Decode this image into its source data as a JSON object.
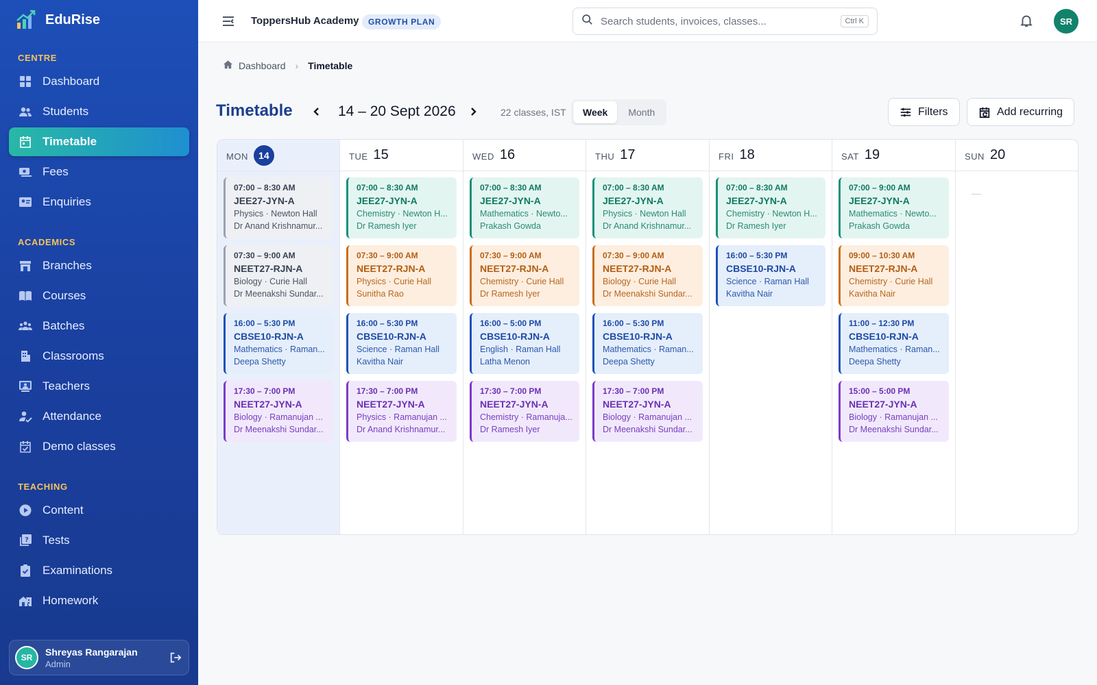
{
  "brand": {
    "name": "EduRise"
  },
  "sidebar": {
    "sections": [
      {
        "title": "CENTRE",
        "items": [
          {
            "label": "Dashboard",
            "icon": "dashboard-icon"
          },
          {
            "label": "Students",
            "icon": "students-icon"
          },
          {
            "label": "Timetable",
            "icon": "calendar-icon",
            "active": true
          },
          {
            "label": "Fees",
            "icon": "fees-icon"
          },
          {
            "label": "Enquiries",
            "icon": "enquiries-icon"
          }
        ]
      },
      {
        "title": "ACADEMICS",
        "items": [
          {
            "label": "Branches",
            "icon": "branches-icon"
          },
          {
            "label": "Courses",
            "icon": "courses-icon"
          },
          {
            "label": "Batches",
            "icon": "batches-icon"
          },
          {
            "label": "Classrooms",
            "icon": "classrooms-icon"
          },
          {
            "label": "Teachers",
            "icon": "teachers-icon"
          },
          {
            "label": "Attendance",
            "icon": "attendance-icon"
          },
          {
            "label": "Demo classes",
            "icon": "demo-classes-icon"
          }
        ]
      },
      {
        "title": "TEACHING",
        "items": [
          {
            "label": "Content",
            "icon": "content-icon"
          },
          {
            "label": "Tests",
            "icon": "tests-icon"
          },
          {
            "label": "Examinations",
            "icon": "examinations-icon"
          },
          {
            "label": "Homework",
            "icon": "homework-icon"
          }
        ]
      }
    ],
    "user": {
      "initials": "SR",
      "name": "Shreyas Rangarajan",
      "role": "Admin"
    }
  },
  "header": {
    "org_name": "ToppersHub Academy",
    "plan_badge": "GROWTH PLAN",
    "search_placeholder": "Search students, invoices, classes...",
    "search_shortcut": "Ctrl K",
    "avatar_initials": "SR"
  },
  "breadcrumb": {
    "home": "Dashboard",
    "current": "Timetable"
  },
  "toolbar": {
    "title": "Timetable",
    "range": "14 – 20 Sept 2026",
    "summary": "22 classes, IST",
    "views": [
      "Week",
      "Month"
    ],
    "active_view": "Week",
    "filters_label": "Filters",
    "add_recurring_label": "Add recurring"
  },
  "colors": {
    "sidebar": "#1d4fb8",
    "accent_active": "#28b8a6",
    "jee_teal": "#16917a",
    "neet_rjn_orange": "#c86e1c",
    "cbse_blue": "#1f52b8",
    "neet_jyn_purple": "#7c3bc8",
    "past_gray": "#9aa3b0"
  },
  "calendar": {
    "days": [
      {
        "name": "MON",
        "date": "14",
        "today": true,
        "events": [
          {
            "time": "07:00 – 8:30 AM",
            "batch": "JEE27-JYN-A",
            "subject": "Physics · Newton Hall",
            "teacher": "Dr Anand Krishnamur...",
            "color": "gray"
          },
          {
            "time": "07:30 – 9:00 AM",
            "batch": "NEET27-RJN-A",
            "subject": "Biology · Curie Hall",
            "teacher": "Dr Meenakshi Sundar...",
            "color": "gray"
          },
          {
            "time": "16:00 – 5:30 PM",
            "batch": "CBSE10-RJN-A",
            "subject": "Mathematics · Raman...",
            "teacher": "Deepa Shetty",
            "color": "blue"
          },
          {
            "time": "17:30 – 7:00 PM",
            "batch": "NEET27-JYN-A",
            "subject": "Biology · Ramanujan ...",
            "teacher": "Dr Meenakshi Sundar...",
            "color": "purple"
          }
        ]
      },
      {
        "name": "TUE",
        "date": "15",
        "events": [
          {
            "time": "07:00 – 8:30 AM",
            "batch": "JEE27-JYN-A",
            "subject": "Chemistry · Newton H...",
            "teacher": "Dr Ramesh Iyer",
            "color": "teal"
          },
          {
            "time": "07:30 – 9:00 AM",
            "batch": "NEET27-RJN-A",
            "subject": "Physics · Curie Hall",
            "teacher": "Sunitha Rao",
            "color": "orange"
          },
          {
            "time": "16:00 – 5:30 PM",
            "batch": "CBSE10-RJN-A",
            "subject": "Science · Raman Hall",
            "teacher": "Kavitha Nair",
            "color": "blue"
          },
          {
            "time": "17:30 – 7:00 PM",
            "batch": "NEET27-JYN-A",
            "subject": "Physics · Ramanujan ...",
            "teacher": "Dr Anand Krishnamur...",
            "color": "purple"
          }
        ]
      },
      {
        "name": "WED",
        "date": "16",
        "events": [
          {
            "time": "07:00 – 8:30 AM",
            "batch": "JEE27-JYN-A",
            "subject": "Mathematics · Newto...",
            "teacher": "Prakash Gowda",
            "color": "teal"
          },
          {
            "time": "07:30 – 9:00 AM",
            "batch": "NEET27-RJN-A",
            "subject": "Chemistry · Curie Hall",
            "teacher": "Dr Ramesh Iyer",
            "color": "orange"
          },
          {
            "time": "16:00 – 5:00 PM",
            "batch": "CBSE10-RJN-A",
            "subject": "English · Raman Hall",
            "teacher": "Latha Menon",
            "color": "blue"
          },
          {
            "time": "17:30 – 7:00 PM",
            "batch": "NEET27-JYN-A",
            "subject": "Chemistry · Ramanuja...",
            "teacher": "Dr Ramesh Iyer",
            "color": "purple"
          }
        ]
      },
      {
        "name": "THU",
        "date": "17",
        "events": [
          {
            "time": "07:00 – 8:30 AM",
            "batch": "JEE27-JYN-A",
            "subject": "Physics · Newton Hall",
            "teacher": "Dr Anand Krishnamur...",
            "color": "teal"
          },
          {
            "time": "07:30 – 9:00 AM",
            "batch": "NEET27-RJN-A",
            "subject": "Biology · Curie Hall",
            "teacher": "Dr Meenakshi Sundar...",
            "color": "orange"
          },
          {
            "time": "16:00 – 5:30 PM",
            "batch": "CBSE10-RJN-A",
            "subject": "Mathematics · Raman...",
            "teacher": "Deepa Shetty",
            "color": "blue"
          },
          {
            "time": "17:30 – 7:00 PM",
            "batch": "NEET27-JYN-A",
            "subject": "Biology · Ramanujan ...",
            "teacher": "Dr Meenakshi Sundar...",
            "color": "purple"
          }
        ]
      },
      {
        "name": "FRI",
        "date": "18",
        "events": [
          {
            "time": "07:00 – 8:30 AM",
            "batch": "JEE27-JYN-A",
            "subject": "Chemistry · Newton H...",
            "teacher": "Dr Ramesh Iyer",
            "color": "teal"
          },
          {
            "time": "16:00 – 5:30 PM",
            "batch": "CBSE10-RJN-A",
            "subject": "Science · Raman Hall",
            "teacher": "Kavitha Nair",
            "color": "blue"
          }
        ]
      },
      {
        "name": "SAT",
        "date": "19",
        "events": [
          {
            "time": "07:00 – 9:00 AM",
            "batch": "JEE27-JYN-A",
            "subject": "Mathematics · Newto...",
            "teacher": "Prakash Gowda",
            "color": "teal"
          },
          {
            "time": "09:00 – 10:30 AM",
            "batch": "NEET27-RJN-A",
            "subject": "Chemistry · Curie Hall",
            "teacher": "Kavitha Nair",
            "color": "orange"
          },
          {
            "time": "11:00 – 12:30 PM",
            "batch": "CBSE10-RJN-A",
            "subject": "Mathematics · Raman...",
            "teacher": "Deepa Shetty",
            "color": "blue"
          },
          {
            "time": "15:00 – 5:00 PM",
            "batch": "NEET27-JYN-A",
            "subject": "Biology · Ramanujan ...",
            "teacher": "Dr Meenakshi Sundar...",
            "color": "purple"
          }
        ]
      },
      {
        "name": "SUN",
        "date": "20",
        "events": []
      }
    ]
  }
}
